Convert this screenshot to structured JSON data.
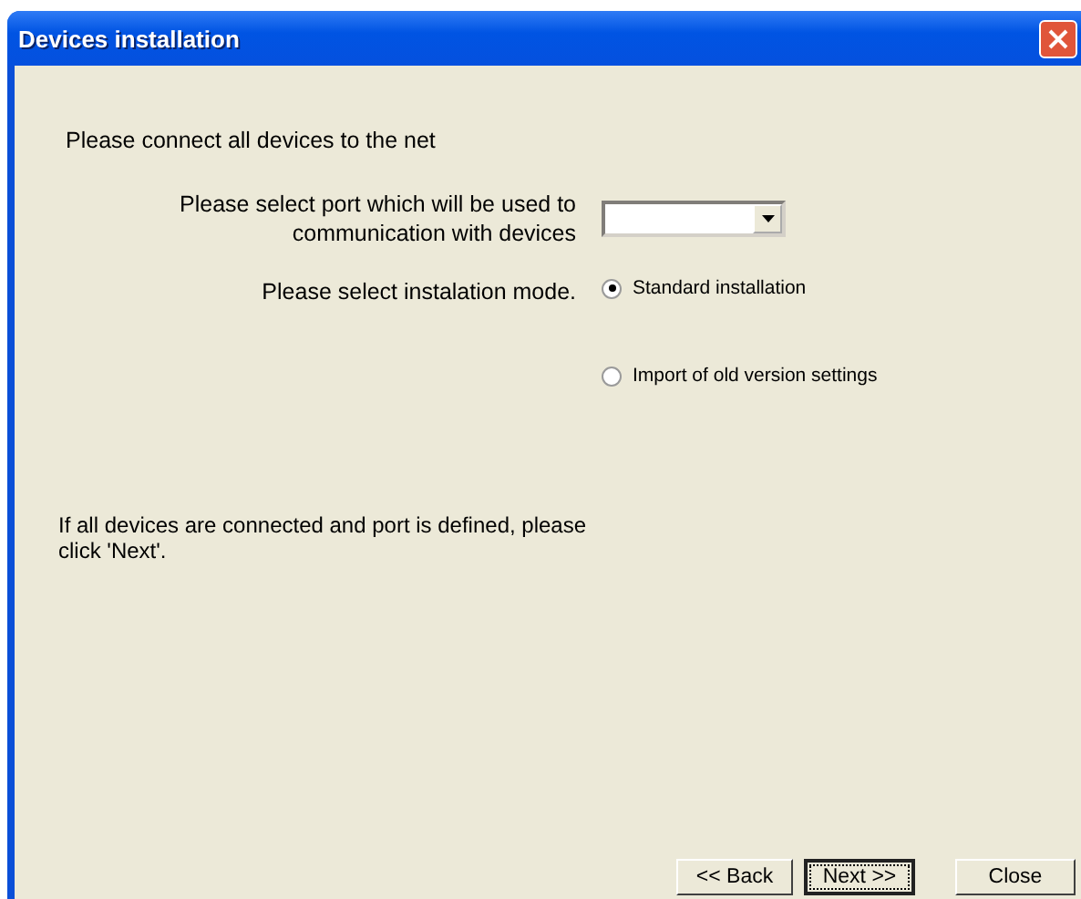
{
  "window": {
    "title": "Devices installation"
  },
  "intro": "Please connect all devices to the net",
  "port": {
    "label": "Please select port which will be used to communication with devices"
  },
  "mode": {
    "label": "Please select instalation mode.",
    "options": [
      {
        "label": "Standard installation",
        "selected": true
      },
      {
        "label": "Import of old version settings",
        "selected": false
      }
    ]
  },
  "hint": "If all devices are connected and port is defined, please click 'Next'.",
  "buttons": [
    {
      "label": "<< Back",
      "focused": false
    },
    {
      "label": "Next >>",
      "focused": true
    },
    {
      "label": "Close",
      "focused": false
    }
  ]
}
